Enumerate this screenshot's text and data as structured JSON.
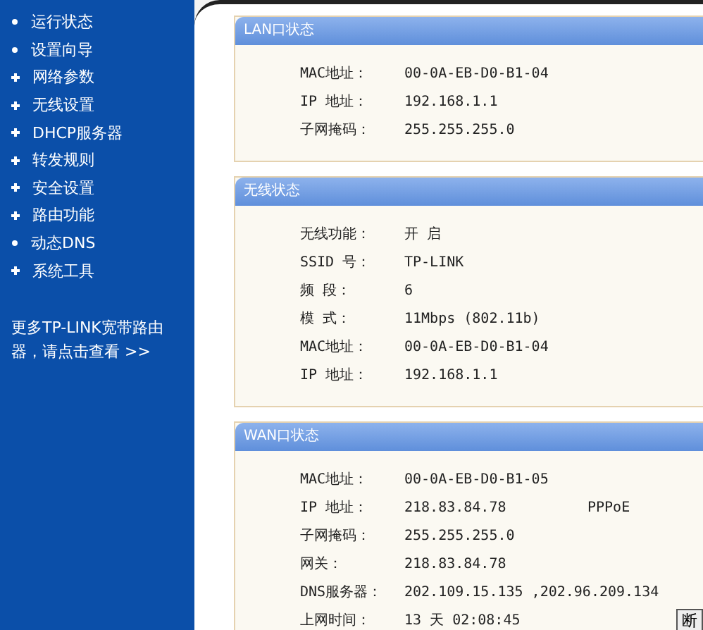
{
  "sidebar": {
    "items": [
      {
        "label": "运行状态",
        "kind": "dot"
      },
      {
        "label": "设置向导",
        "kind": "dot"
      },
      {
        "label": "网络参数",
        "kind": "plus"
      },
      {
        "label": "无线设置",
        "kind": "plus"
      },
      {
        "label": "DHCP服务器",
        "kind": "plus"
      },
      {
        "label": "转发规则",
        "kind": "plus"
      },
      {
        "label": "安全设置",
        "kind": "plus"
      },
      {
        "label": "路由功能",
        "kind": "plus"
      },
      {
        "label": "动态DNS",
        "kind": "dot"
      },
      {
        "label": "系统工具",
        "kind": "plus"
      }
    ],
    "footer": "更多TP-LINK宽带路由器，请点击查看 >>"
  },
  "panels": [
    {
      "title": "LAN口状态",
      "rows": [
        {
          "label": "MAC地址：",
          "value": "00-0A-EB-D0-B1-04"
        },
        {
          "label": "IP 地址：",
          "value": "192.168.1.1"
        },
        {
          "label": "子网掩码：",
          "value": "255.255.255.0"
        }
      ]
    },
    {
      "title": "无线状态",
      "rows": [
        {
          "label": "无线功能：",
          "value": "开 启"
        },
        {
          "label": "SSID 号：",
          "value": "TP-LINK"
        },
        {
          "label": "频 段：",
          "value": "6"
        },
        {
          "label": "模 式：",
          "value": "11Mbps (802.11b)"
        },
        {
          "label": "MAC地址：",
          "value": "00-0A-EB-D0-B1-04"
        },
        {
          "label": "IP 地址：",
          "value": "192.168.1.1"
        }
      ]
    },
    {
      "title": "WAN口状态",
      "rows": [
        {
          "label": "MAC地址：",
          "value": "00-0A-EB-D0-B1-05"
        },
        {
          "label": "IP 地址：",
          "value": "218.83.84.78",
          "extra": "PPPoE"
        },
        {
          "label": "子网掩码：",
          "value": "255.255.255.0"
        },
        {
          "label": "网关：",
          "value": "218.83.84.78"
        },
        {
          "label": "DNS服务器：",
          "value": "202.109.15.135 ,202.96.209.134"
        },
        {
          "label": "上网时间：",
          "value": "13 天 02:08:45",
          "button": "断"
        }
      ]
    }
  ]
}
